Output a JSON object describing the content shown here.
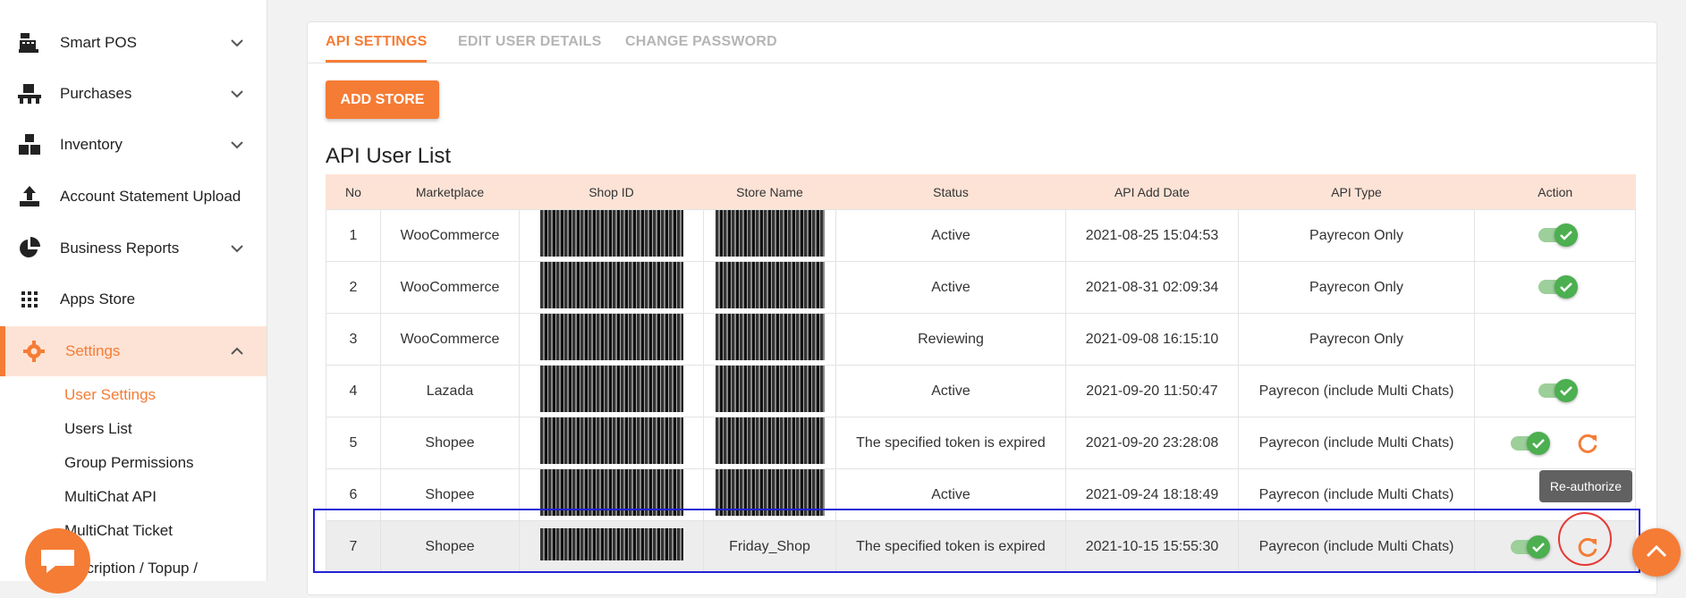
{
  "sidebar": {
    "items": [
      {
        "label": "Smart POS",
        "icon": "register-icon"
      },
      {
        "label": "Purchases",
        "icon": "pallet-icon"
      },
      {
        "label": "Inventory",
        "icon": "boxes-icon"
      },
      {
        "label": "Account Statement Upload",
        "icon": "upload-icon"
      },
      {
        "label": "Business Reports",
        "icon": "pie-chart-icon"
      },
      {
        "label": "Apps Store",
        "icon": "grid-icon"
      },
      {
        "label": "Settings",
        "icon": "gear-icon"
      }
    ],
    "sub_items": [
      {
        "label": "User Settings"
      },
      {
        "label": "Users List"
      },
      {
        "label": "Group Permissions"
      },
      {
        "label": "MultiChat API"
      },
      {
        "label": "MultiChat Ticket"
      },
      {
        "label": "scription / Topup /"
      }
    ]
  },
  "tabs": [
    {
      "label": "API SETTINGS"
    },
    {
      "label": "EDIT USER DETAILS"
    },
    {
      "label": "CHANGE PASSWORD"
    }
  ],
  "add_store_label": "ADD STORE",
  "section_title": "API User List",
  "table": {
    "headers": [
      "No",
      "Marketplace",
      "Shop ID",
      "Store Name",
      "Status",
      "API Add Date",
      "API Type",
      "Action"
    ],
    "rows": [
      {
        "no": "1",
        "marketplace": "WooCommerce",
        "store_name": "",
        "status": "Active",
        "date": "2021-08-25 15:04:53",
        "type": "Payrecon Only"
      },
      {
        "no": "2",
        "marketplace": "WooCommerce",
        "store_name": "",
        "status": "Active",
        "date": "2021-08-31 02:09:34",
        "type": "Payrecon Only"
      },
      {
        "no": "3",
        "marketplace": "WooCommerce",
        "store_name": "",
        "status": "Reviewing",
        "date": "2021-09-08 16:15:10",
        "type": "Payrecon Only"
      },
      {
        "no": "4",
        "marketplace": "Lazada",
        "store_name": "",
        "status": "Active",
        "date": "2021-09-20 11:50:47",
        "type": "Payrecon (include Multi Chats)"
      },
      {
        "no": "5",
        "marketplace": "Shopee",
        "store_name": "",
        "status": "The specified token is expired",
        "date": "2021-09-20 23:28:08",
        "type": "Payrecon (include Multi Chats)"
      },
      {
        "no": "6",
        "marketplace": "Shopee",
        "store_name": "",
        "status": "Active",
        "date": "2021-09-24 18:18:49",
        "type": "Payrecon (include Multi Chats)"
      },
      {
        "no": "7",
        "marketplace": "Shopee",
        "store_name": "Friday_Shop",
        "status": "The specified token is expired",
        "date": "2021-10-15 15:55:30",
        "type": "Payrecon (include Multi Chats)"
      }
    ]
  },
  "tooltip": "Re-authorize",
  "colors": {
    "accent": "#f57c35",
    "toggle_on": "#4caf50",
    "header_bg": "#fde3d6",
    "highlight_box": "#2222d6",
    "ring": "#e53935"
  }
}
